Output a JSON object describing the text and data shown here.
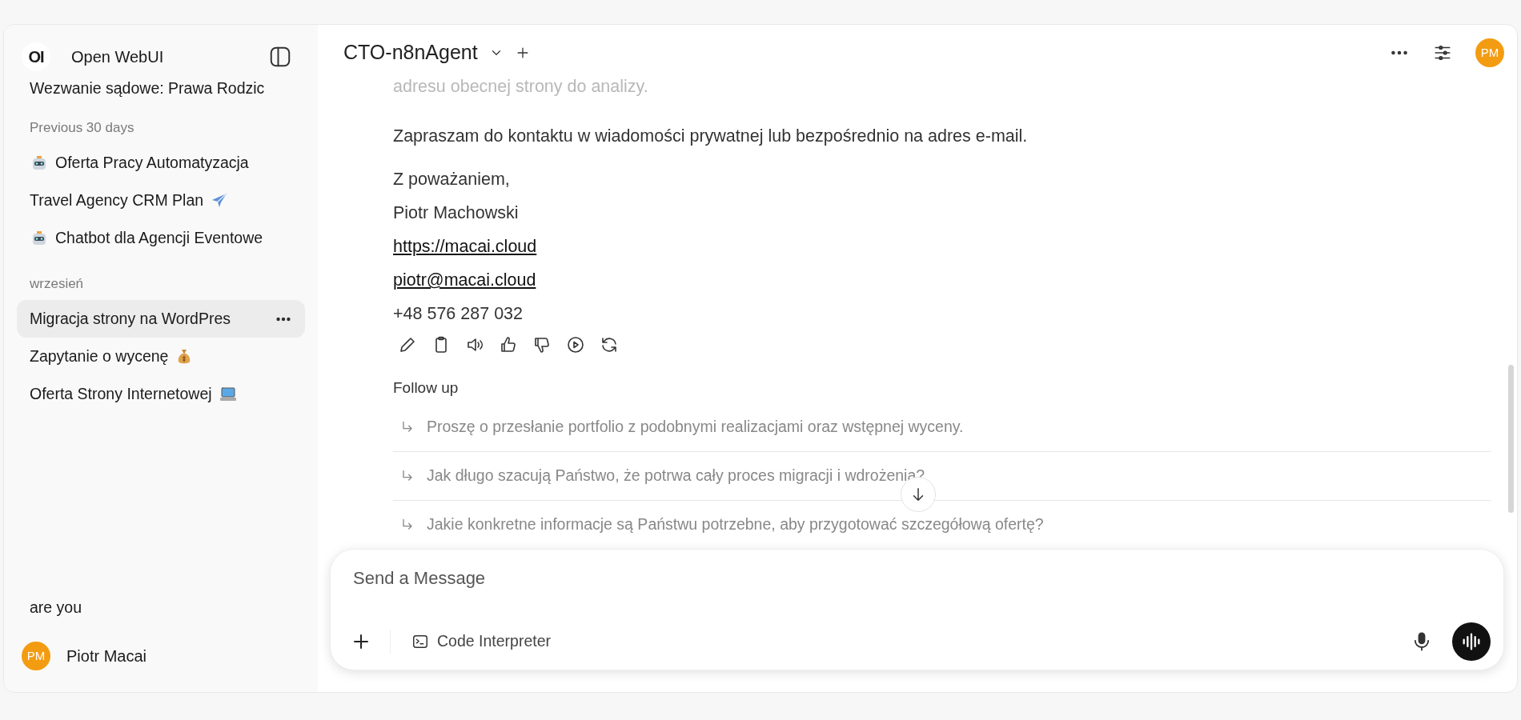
{
  "sidebar": {
    "logo": "OI",
    "app_name": "Open WebUI",
    "top_chat": {
      "title": "Wezwanie sądowe: Prawa Rodzic"
    },
    "groups": [
      {
        "label": "Previous 30 days",
        "items": [
          {
            "title": "Oferta Pracy Automatyzacja",
            "selected": false
          },
          {
            "title": "Travel Agency CRM Plan",
            "selected": false
          },
          {
            "title": "Chatbot dla Agencji Eventowe",
            "selected": false
          }
        ]
      },
      {
        "label": "wrzesień",
        "items": [
          {
            "title": "Migracja strony na WordPres",
            "selected": true
          },
          {
            "title": "Zapytanie o wycenę",
            "selected": false
          },
          {
            "title": "Oferta Strony Internetowej",
            "selected": false
          }
        ]
      }
    ],
    "bottom_item": "are you",
    "user": {
      "initials": "PM",
      "name": "Piotr Macai"
    }
  },
  "header": {
    "model": "CTO-n8nAgent",
    "avatar": "PM"
  },
  "message": {
    "lines": [
      {
        "kind": "faded",
        "text": "adresu obecnej strony do analizy."
      },
      {
        "kind": "paragraph",
        "text": "Zapraszam do kontaktu w wiadomości prywatnej lub bezpośrednio na adres e-mail."
      },
      {
        "kind": "line",
        "text": "Z poważaniem,"
      },
      {
        "kind": "line",
        "text": "Piotr Machowski"
      },
      {
        "kind": "link",
        "text": "https://macai.cloud"
      },
      {
        "kind": "link",
        "text": "piotr@macai.cloud"
      },
      {
        "kind": "line",
        "text": "+48 576 287 032"
      }
    ]
  },
  "follow_up": {
    "title": "Follow up",
    "items": [
      "Proszę o przesłanie portfolio z podobnymi realizacjami oraz wstępnej wyceny.",
      "Jak długo szacują Państwo, że potrwa cały proces migracji i wdrożenia?",
      "Jakie konkretne informacje są Państwu potrzebne, aby przygotować szczegółową ofertę?"
    ]
  },
  "composer": {
    "placeholder": "Send a Message",
    "tool": "Code Interpreter"
  }
}
